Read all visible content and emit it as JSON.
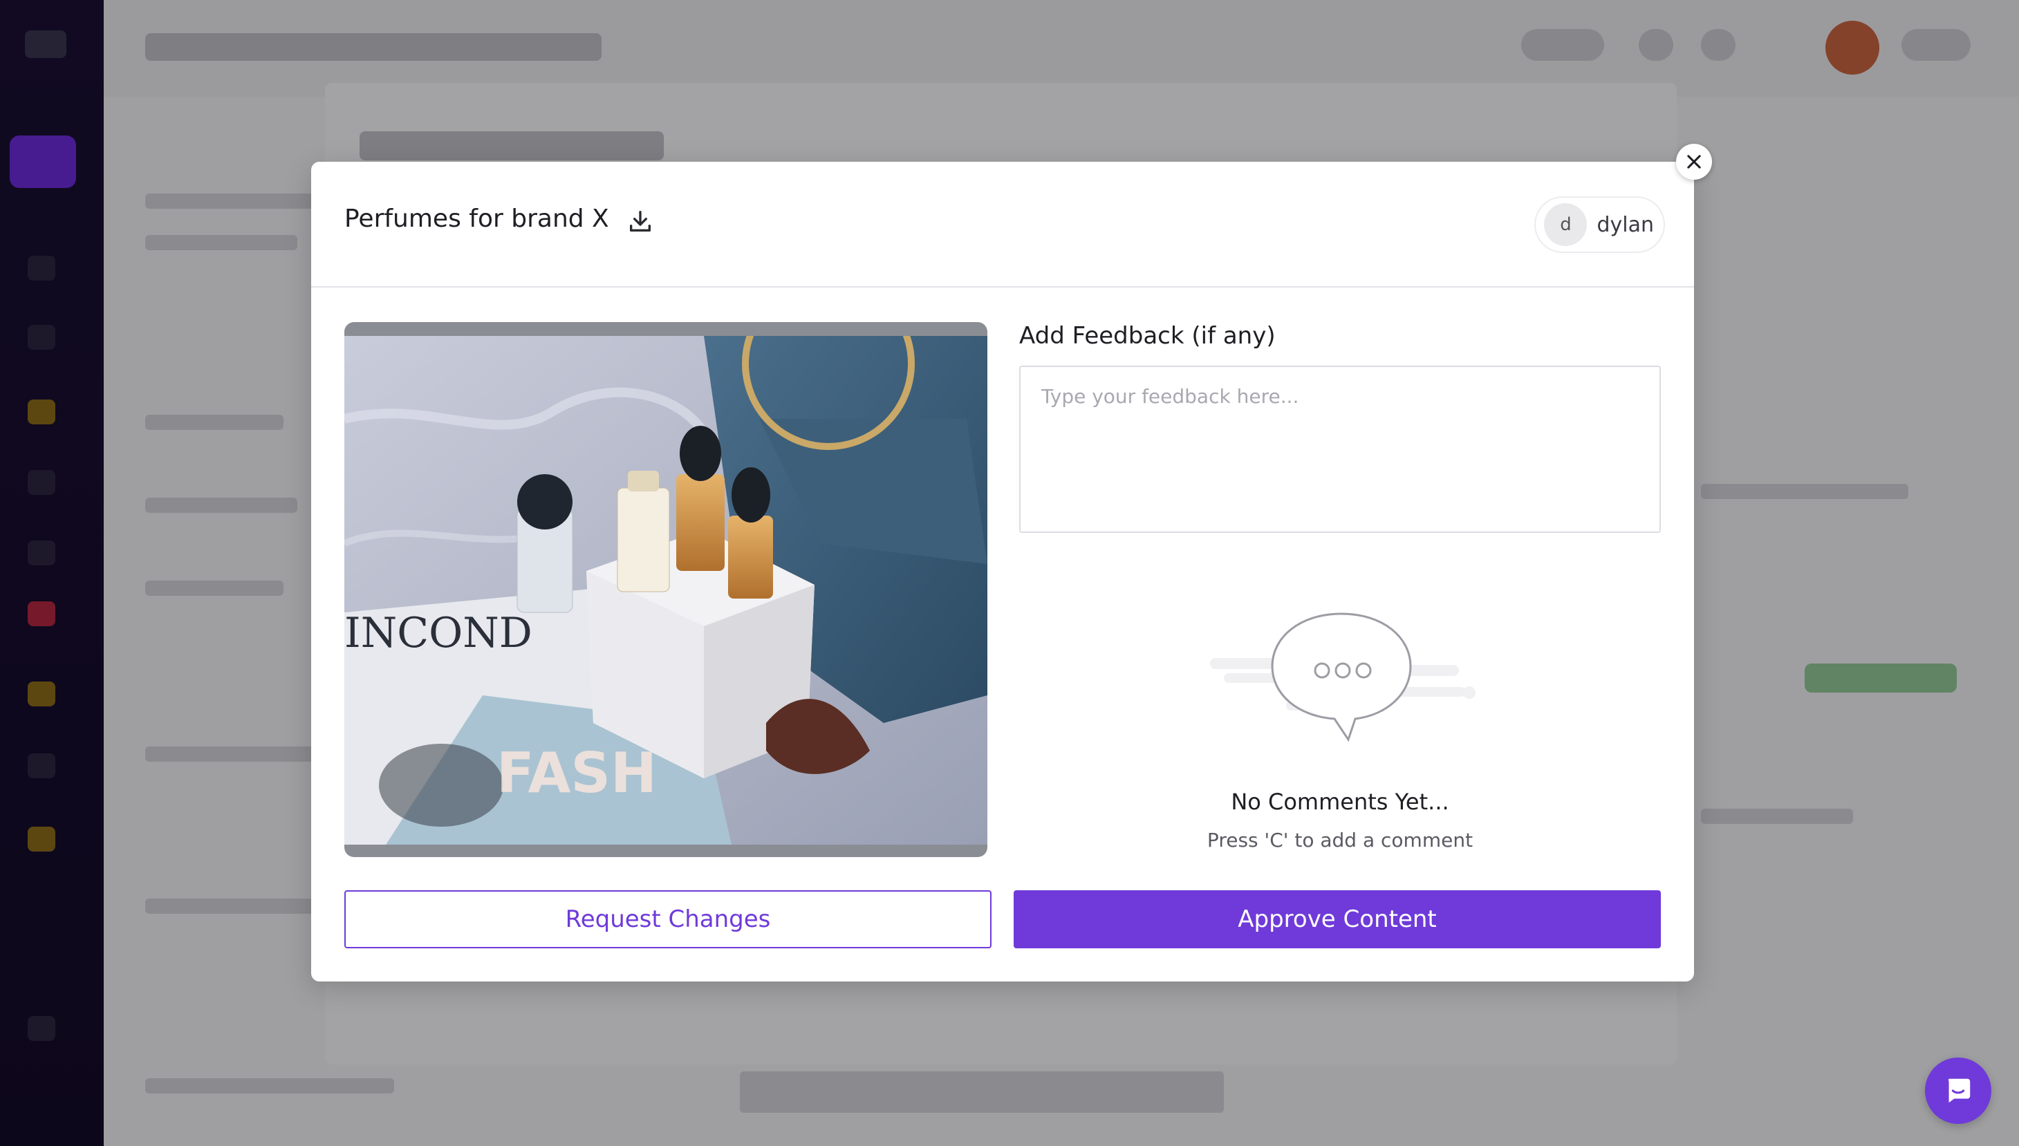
{
  "modal": {
    "title": "Perfumes for brand X",
    "user": {
      "initial": "d",
      "name": "dylan"
    },
    "feedback": {
      "label": "Add Feedback (if any)",
      "placeholder": "Type your feedback here...",
      "value": ""
    },
    "empty_state": {
      "title": "No Comments Yet...",
      "subtitle": "Press 'C' to add a comment"
    },
    "buttons": {
      "request_changes": "Request Changes",
      "approve": "Approve Content"
    }
  },
  "colors": {
    "accent": "#6f3ad9",
    "sidebar": "#1a1033",
    "overlay": "rgba(0,0,0,0.33)"
  },
  "icons": {
    "download": "download-icon",
    "close": "close-icon",
    "chat": "chat-icon",
    "empty_comments": "speech-bubble-icon"
  }
}
